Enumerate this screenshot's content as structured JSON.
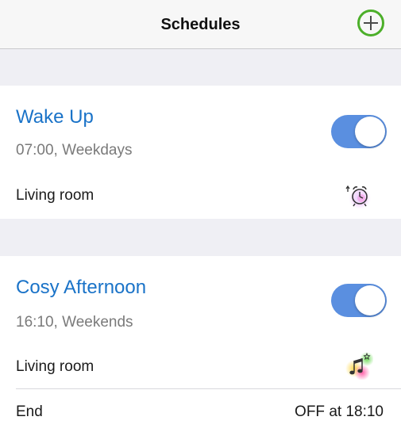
{
  "navbar": {
    "title": "Schedules",
    "add_icon": "plus-circle-icon",
    "accent_color": "#4caf2a"
  },
  "schedules": [
    {
      "name": "Wake Up",
      "time": "07:00, Weekdays",
      "enabled": true,
      "room": "Living room",
      "scene_icon": "alarm-clock-icon"
    },
    {
      "name": "Cosy Afternoon",
      "time": "16:10, Weekends",
      "enabled": true,
      "room": "Living room",
      "scene_icon": "music-notes-icon",
      "end_label": "End",
      "end_value": "OFF at 18:10"
    }
  ],
  "colors": {
    "link_blue": "#1a73c8",
    "toggle_on": "#5a8fe0",
    "background": "#efeff4"
  }
}
